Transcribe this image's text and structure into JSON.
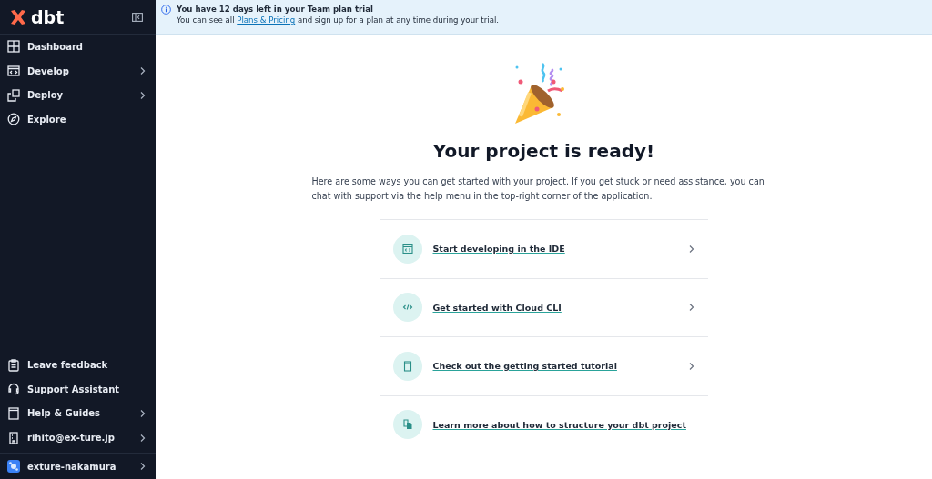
{
  "sidebar": {
    "logo": "dbt",
    "nav": [
      {
        "kind": "dashboard",
        "label": "Dashboard",
        "submenu": false
      },
      {
        "kind": "develop",
        "label": "Develop",
        "submenu": true
      },
      {
        "kind": "deploy",
        "label": "Deploy",
        "submenu": true
      },
      {
        "kind": "explore",
        "label": "Explore",
        "submenu": false
      }
    ],
    "footer": [
      {
        "kind": "feedback",
        "label": "Leave feedback",
        "submenu": false
      },
      {
        "kind": "support",
        "label": "Support Assistant",
        "submenu": false
      },
      {
        "kind": "help",
        "label": "Help & Guides",
        "submenu": true
      },
      {
        "kind": "user",
        "label": "rihito@ex-ture.jp",
        "submenu": true
      }
    ],
    "account": {
      "label": "exture-nakamura",
      "submenu": true
    }
  },
  "banner": {
    "title": "You have 12 days left in your Team plan trial",
    "before": "You can see all",
    "link": "Plans & Pricing",
    "after": "and sign up for a plan at any time during your trial."
  },
  "main": {
    "title": "Your project is ready!",
    "intro": "Here are some ways you can get started with your project. If you get stuck or need assistance, you can chat with support via the help menu in the top-right corner of the application.",
    "actions": [
      {
        "kind": "ide",
        "label": "Start developing in the IDE"
      },
      {
        "kind": "cli",
        "label": "Get started with Cloud CLI"
      },
      {
        "kind": "tutorial",
        "label": "Check out the getting started tutorial"
      },
      {
        "kind": "docs",
        "label": "Learn more about how to structure your dbt project"
      }
    ]
  }
}
